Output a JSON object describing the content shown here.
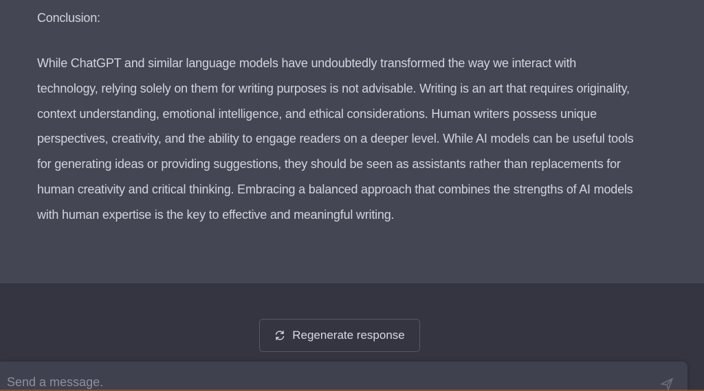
{
  "message": {
    "heading": "Conclusion:",
    "body": "While ChatGPT and similar language models have undoubtedly transformed the way we interact with technology, relying solely on them for writing purposes is not advisable. Writing is an art that requires originality, context understanding, emotional intelligence, and ethical considerations. Human writers possess unique perspectives, creativity, and the ability to engage readers on a deeper level. While AI models can be useful tools for generating ideas or providing suggestions, they should be seen as assistants rather than replacements for human creativity and critical thinking. Embracing a balanced approach that combines the strengths of AI models with human expertise is the key to effective and meaningful writing."
  },
  "controls": {
    "regenerate_label": "Regenerate response",
    "regenerate_icon": "refresh-icon"
  },
  "composer": {
    "placeholder": "Send a message.",
    "send_icon": "send-icon"
  },
  "colors": {
    "message_bg": "#444654",
    "page_bg": "#343541",
    "text": "#d1d5db",
    "input_bg": "#40414f"
  }
}
